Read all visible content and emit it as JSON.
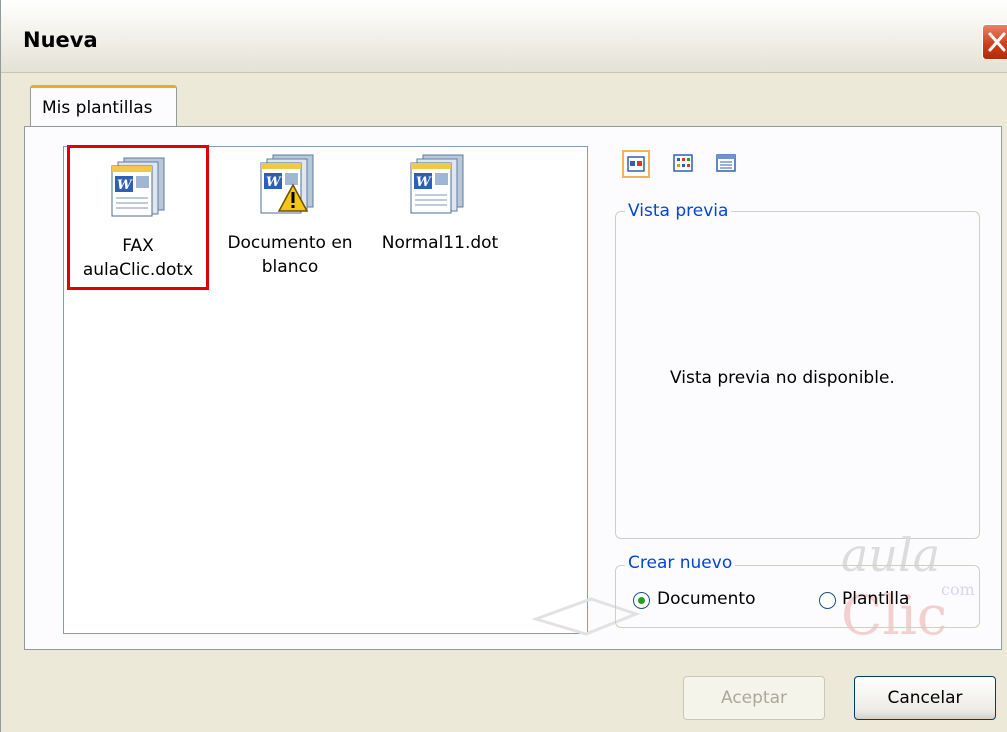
{
  "window": {
    "title": "Nueva"
  },
  "tabs": [
    {
      "label": "Mis plantillas"
    }
  ],
  "templates": [
    {
      "line1": "FAX",
      "line2": "aulaClic.dotx",
      "icon": "word-template-icon",
      "selected": true
    },
    {
      "line1": "Documento en",
      "line2": "blanco",
      "icon": "word-template-warning-icon",
      "selected": false
    },
    {
      "line1": "Normal11.dot",
      "line2": "",
      "icon": "word-template-icon",
      "selected": false
    }
  ],
  "view_buttons": [
    {
      "icon": "large-icons-view-icon",
      "active": true
    },
    {
      "icon": "list-view-icon",
      "active": false
    },
    {
      "icon": "details-view-icon",
      "active": false
    }
  ],
  "preview": {
    "title": "Vista previa",
    "message": "Vista previa no disponible."
  },
  "create_new": {
    "title": "Crear nuevo",
    "options": [
      {
        "label": "Documento",
        "checked": true
      },
      {
        "label": "Plantilla",
        "checked": false
      }
    ]
  },
  "watermark": {
    "line1": "aula",
    "line2": "Clic",
    "suffix": "com"
  },
  "buttons": {
    "accept": "Aceptar",
    "cancel": "Cancelar"
  },
  "colors": {
    "selection_border": "#e00000",
    "tab_accent": "#f5a623",
    "group_title": "#0046d5"
  }
}
